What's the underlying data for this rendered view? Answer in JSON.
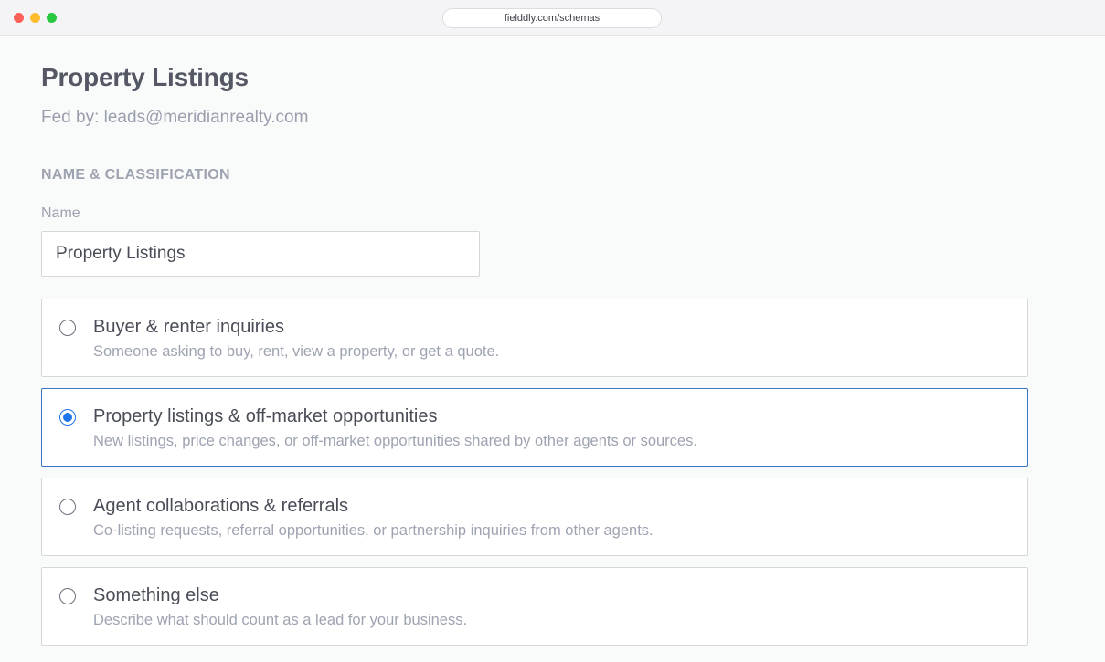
{
  "browser": {
    "url": "fielddly.com/schemas"
  },
  "page": {
    "title": "Property Listings",
    "subtitle": "Fed by: leads@meridianrealty.com",
    "section_label": "NAME & CLASSIFICATION",
    "name_field": {
      "label": "Name",
      "value": "Property Listings"
    }
  },
  "options": [
    {
      "title": "Buyer & renter inquiries",
      "description": "Someone asking to buy, rent, view a property, or get a quote.",
      "selected": false
    },
    {
      "title": "Property listings & off-market opportunities",
      "description": "New listings, price changes, or off-market opportunities shared by other agents or sources.",
      "selected": true
    },
    {
      "title": "Agent collaborations & referrals",
      "description": "Co-listing requests, referral opportunities, or partnership inquiries from other agents.",
      "selected": false
    },
    {
      "title": "Something else",
      "description": "Describe what should count as a lead for your business.",
      "selected": false
    }
  ],
  "colors": {
    "accent": "#1e74e8",
    "selected_border": "#3a74c4",
    "window_close": "#fe5f57",
    "window_minimize": "#febc2e",
    "window_zoom": "#28c840"
  }
}
